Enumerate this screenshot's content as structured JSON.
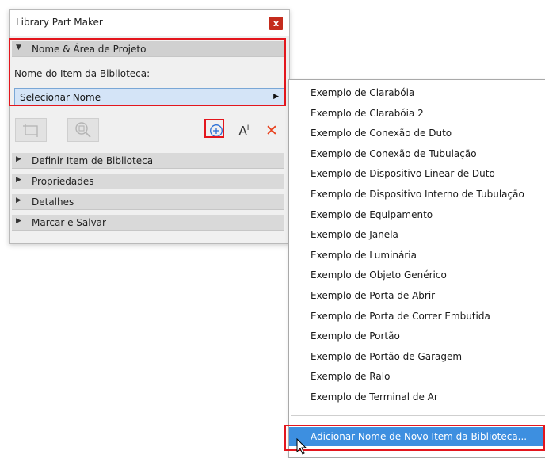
{
  "window": {
    "title": "Library Part Maker",
    "close_label": "x"
  },
  "sections": {
    "name_area": "Nome & Área de Projeto",
    "define_item": "Definir Item de Biblioteca",
    "properties": "Propriedades",
    "details": "Detalhes",
    "mark_save": "Marcar e Salvar"
  },
  "field": {
    "label": "Nome do Item da Biblioteca:",
    "select_value": "Selecionar Nome"
  },
  "toolbar": {
    "text_style_label": "A",
    "text_style_sup": "I",
    "delete_label": "✕"
  },
  "menu": {
    "items": [
      "Exemplo de Clarabóia",
      "Exemplo de Clarabóia 2",
      "Exemplo de Conexão de Duto",
      "Exemplo de Conexão de Tubulação",
      "Exemplo de Dispositivo Linear de Duto",
      "Exemplo de Dispositivo Interno de Tubulação",
      "Exemplo de Equipamento",
      "Exemplo de Janela",
      "Exemplo de Luminária",
      "Exemplo de Objeto Genérico",
      "Exemplo de Porta de Abrir",
      "Exemplo de Porta de Correr Embutida",
      "Exemplo de Portão",
      "Exemplo de Portão de Garagem",
      "Exemplo de Ralo",
      "Exemplo de Terminal de Ar"
    ],
    "add_new": "Adicionar Nome de Novo Item da Biblioteca..."
  },
  "colors": {
    "highlight_red": "#e3161d",
    "menu_selected": "#3d8fe0",
    "select_fill": "#d4e4f7",
    "close_red": "#c42b1c"
  }
}
